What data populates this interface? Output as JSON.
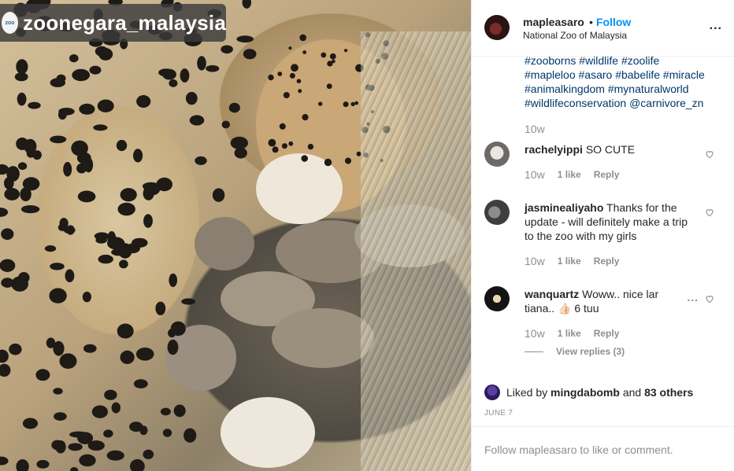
{
  "photo": {
    "overlay_username": "zoonegara_malaysia",
    "badge_logo_text": "zoo"
  },
  "header": {
    "username": "mapleasaro",
    "separator": "•",
    "follow_label": "Follow",
    "location": "National Zoo of Malaysia",
    "more_label": "..."
  },
  "caption": {
    "hashtags": [
      "#zooborns",
      "#wildlife",
      "#zoolife",
      "#mapleloo",
      "#asaro",
      "#babelife",
      "#miracle",
      "#animalkingdom",
      "#mynaturalworld",
      "#wildlifeconservation",
      "@carnivore_zn"
    ],
    "time": "10w"
  },
  "comments": [
    {
      "username": "rachelyippi",
      "text": "SO CUTE",
      "time": "10w",
      "likes": "1 like",
      "reply": "Reply"
    },
    {
      "username": "jasminealiyaho",
      "text": "Thanks for the update - will definitely make a trip to the zoo with my girls",
      "time": "10w",
      "likes": "1 like",
      "reply": "Reply"
    },
    {
      "username": "wanquartz",
      "text": "Woww.. nice lar tiana.. 👍🏻 6 tuu",
      "time": "10w",
      "likes": "1 like",
      "reply": "Reply",
      "more": "..."
    }
  ],
  "view_replies": "View replies (3)",
  "likes": {
    "prefix": "Liked by",
    "user": "mingdabomb",
    "and": "and",
    "others": "83 others"
  },
  "date": "JUNE 7",
  "footer_text": "Follow mapleasaro to like or comment.",
  "colors": {
    "link": "#00376b",
    "follow": "#0095f6",
    "muted": "#8e8e8e",
    "text": "#262626"
  },
  "icons": {
    "heart": "heart-outline-icon",
    "more": "more-horizontal-icon"
  }
}
